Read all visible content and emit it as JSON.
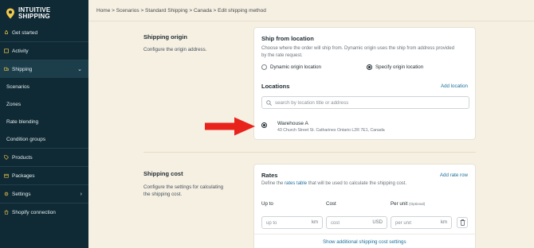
{
  "brand": {
    "line1": "INTUITIVE",
    "line2": "SHIPPING",
    "accent": "#f2c94c",
    "sidebar_bg": "#0f2a35"
  },
  "sidebar": {
    "items": [
      {
        "label": "Get started",
        "icon": "rocket-icon"
      },
      {
        "label": "Activity",
        "icon": "activity-icon"
      },
      {
        "label": "Shipping",
        "icon": "truck-icon",
        "chevron": "⌄"
      },
      {
        "label": "Scenarios"
      },
      {
        "label": "Zones"
      },
      {
        "label": "Rate blending"
      },
      {
        "label": "Condition groups"
      },
      {
        "label": "Products",
        "icon": "tag-icon"
      },
      {
        "label": "Packages",
        "icon": "box-icon"
      },
      {
        "label": "Settings",
        "icon": "gear-icon",
        "chevron": "›"
      },
      {
        "label": "Shopify connection",
        "icon": "shopify-icon"
      }
    ]
  },
  "breadcrumb": "Home > Scenarios > Standard Shipping > Canada > Edit shipping method",
  "shipping_origin": {
    "title": "Shipping origin",
    "description": "Configure the origin address.",
    "card": {
      "title": "Ship from location",
      "text_line1": "Choose where the order will ship from. Dynamic origin uses the ship from address provided",
      "text_line2": "by the rate request.",
      "options": [
        {
          "label": "Dynamic origin location",
          "selected": false
        },
        {
          "label": "Specify origin location",
          "selected": true
        }
      ],
      "locations_title": "Locations",
      "add_location": "Add location",
      "search_placeholder": "search by location title or address",
      "location": {
        "name": "Warehouse A",
        "address": "43 Church Street St. Catharines Ontario L2R 7E1, Canada",
        "selected": true
      }
    }
  },
  "shipping_cost": {
    "title": "Shipping cost",
    "description_line1": "Configure the settings for calculating",
    "description_line2": "the shipping cost.",
    "card": {
      "title": "Rates",
      "add_rate": "Add rate row",
      "text_before": "Define the ",
      "text_link": "rates table",
      "text_after": " that will be used to calculate the shipping cost.",
      "columns": {
        "up_to": "Up to",
        "cost": "Cost",
        "per_unit": "Per unit",
        "optional": "(Optional)"
      },
      "row": {
        "up_to_placeholder": "up to",
        "up_to_unit": "km",
        "cost_placeholder": "cost",
        "cost_unit": "USD",
        "per_unit_placeholder": "per unit",
        "per_unit_unit": "km"
      },
      "show_more": "Show additional shipping cost settings"
    }
  },
  "colors": {
    "link": "#1a6f9c",
    "arrow": "#e8231b",
    "background": "#f6f0e3"
  }
}
